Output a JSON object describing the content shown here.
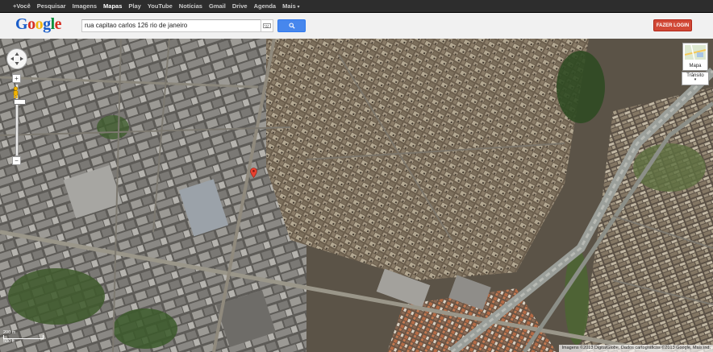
{
  "topbar": {
    "items": [
      "+Você",
      "Pesquisar",
      "Imagens",
      "Mapas",
      "Play",
      "YouTube",
      "Notícias",
      "Gmail",
      "Drive",
      "Agenda",
      "Mais"
    ],
    "active": "Mapas"
  },
  "logo": {
    "letters": [
      "G",
      "o",
      "o",
      "g",
      "l",
      "e"
    ]
  },
  "search": {
    "value": "rua capitao carlos 126 rio de janeiro"
  },
  "login": {
    "label": "FAZER LOGIN"
  },
  "map_controls": {
    "zoom_in": "+",
    "zoom_out": "−",
    "zoom_level_fraction": 0.78
  },
  "map_type": {
    "label": "Mapa",
    "layer": "Trânsito"
  },
  "scale": {
    "top": "200 m",
    "bottom": "500 ft"
  },
  "attribution": "Imagens ©2013 DigitalGlobe, Dados cartográficos ©2013 Google, Mais ind.",
  "colors": {
    "topbar": "#2d2d2d",
    "search_button": "#4787ed",
    "login_button": "#d14836",
    "marker": "#e8402f"
  }
}
